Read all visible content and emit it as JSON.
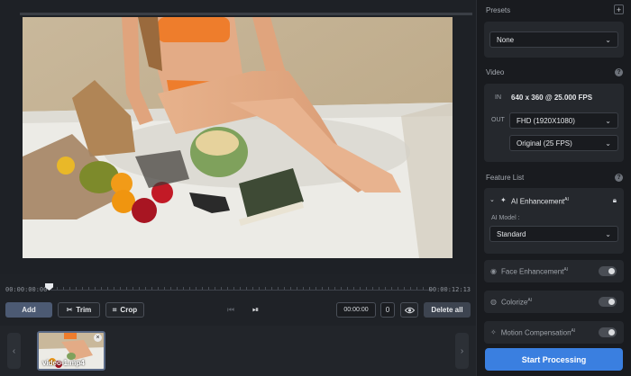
{
  "timeline": {
    "start_time": "00:00:00:00",
    "end_time": "00:00:12:13"
  },
  "controls": {
    "add_label": "Add",
    "trim_label": "Trim",
    "crop_label": "Crop",
    "time_value": "00:00:00",
    "frame_value": "0",
    "delete_all_label": "Delete all"
  },
  "clips": [
    {
      "label": "video-1.mp4"
    }
  ],
  "presets": {
    "title": "Presets",
    "selected": "None"
  },
  "video": {
    "title": "Video",
    "in_label": "IN",
    "in_resolution": "640 x 360",
    "in_fps": "@ 25.000 FPS",
    "out_label": "OUT",
    "out_resolution": "FHD (1920X1080)",
    "out_fps": "Original (25 FPS)"
  },
  "features": {
    "title": "Feature List",
    "ai_enhancement": {
      "label": "AI Enhancement",
      "badge": "AI",
      "model_label": "AI Model :",
      "model_value": "Standard"
    },
    "items": [
      {
        "label": "Face Enhancement",
        "badge": "AI"
      },
      {
        "label": "Colorize",
        "badge": "AI"
      },
      {
        "label": "Motion Compensation",
        "badge": "AI"
      }
    ]
  },
  "start_button": "Start Processing",
  "colors": {
    "accent": "#3a7fe0",
    "panel": "#25282d",
    "background": "#191b1f"
  }
}
